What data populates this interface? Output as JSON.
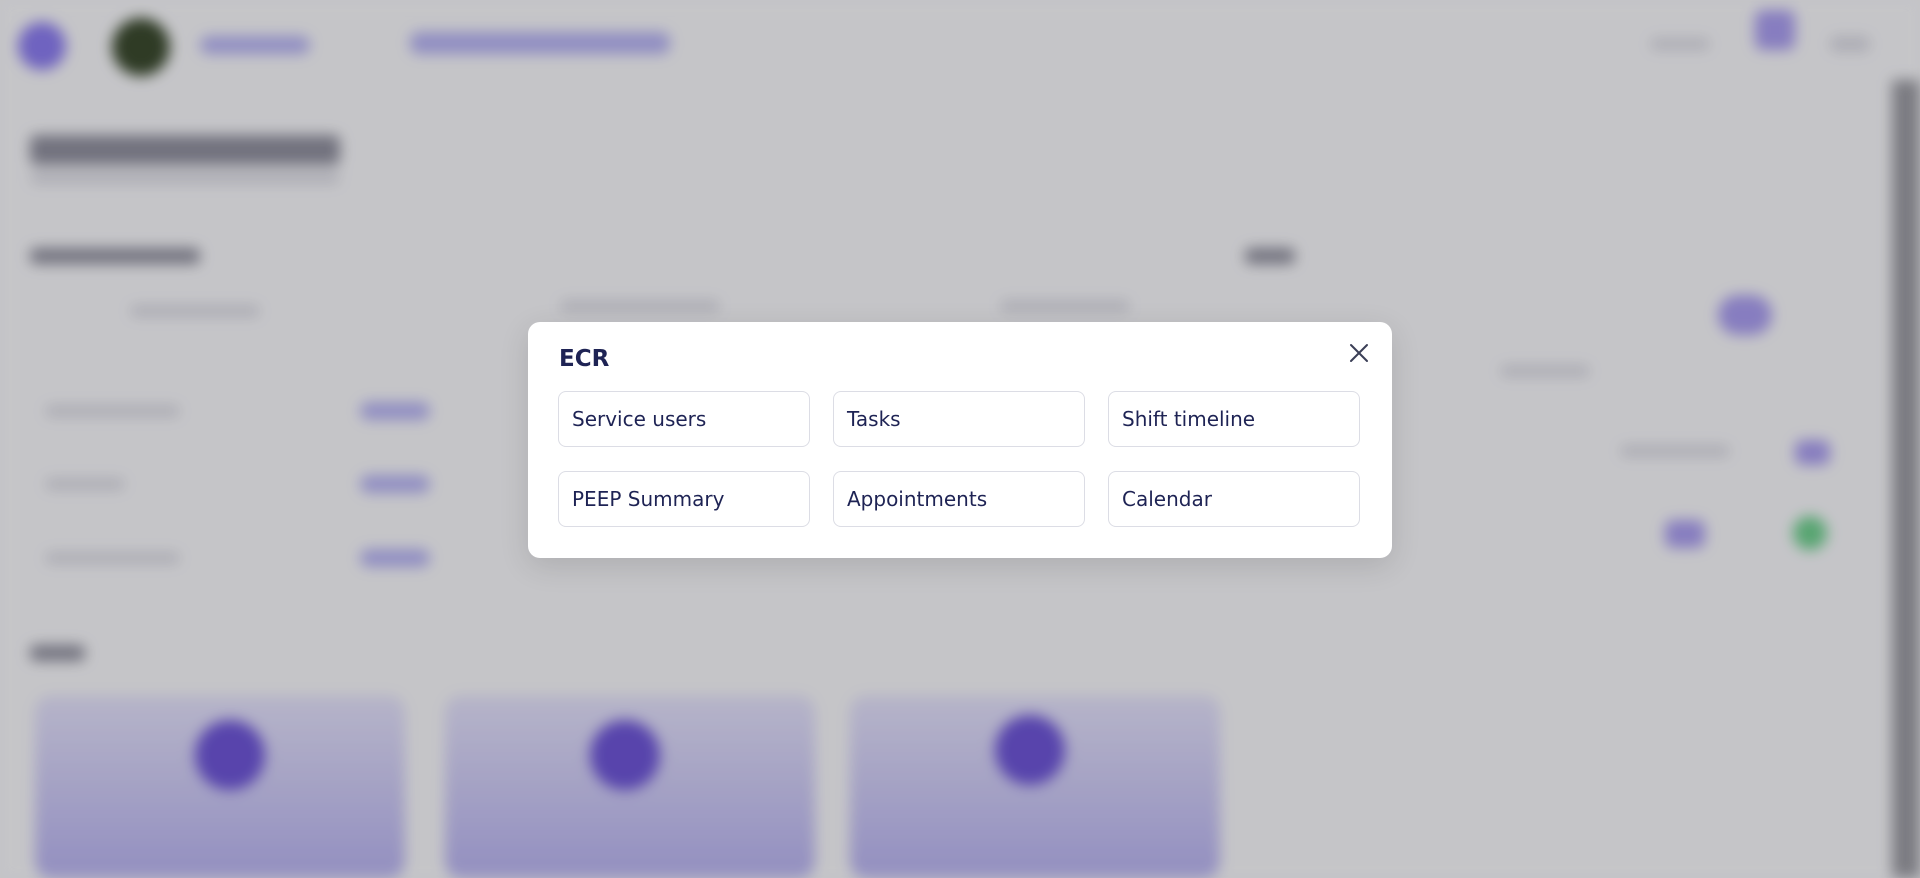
{
  "modal": {
    "title": "ECR",
    "close_icon": "close-icon",
    "items": [
      {
        "label": "Service users"
      },
      {
        "label": "Tasks"
      },
      {
        "label": "Shift timeline"
      },
      {
        "label": "PEEP Summary"
      },
      {
        "label": "Appointments"
      },
      {
        "label": "Calendar"
      }
    ]
  },
  "colors": {
    "modal_text": "#1e2354",
    "modal_background": "#ffffff",
    "item_border": "#dcdde5",
    "overlay": "rgba(0,0,0,0.20)",
    "accent": "#8b7cf0"
  }
}
